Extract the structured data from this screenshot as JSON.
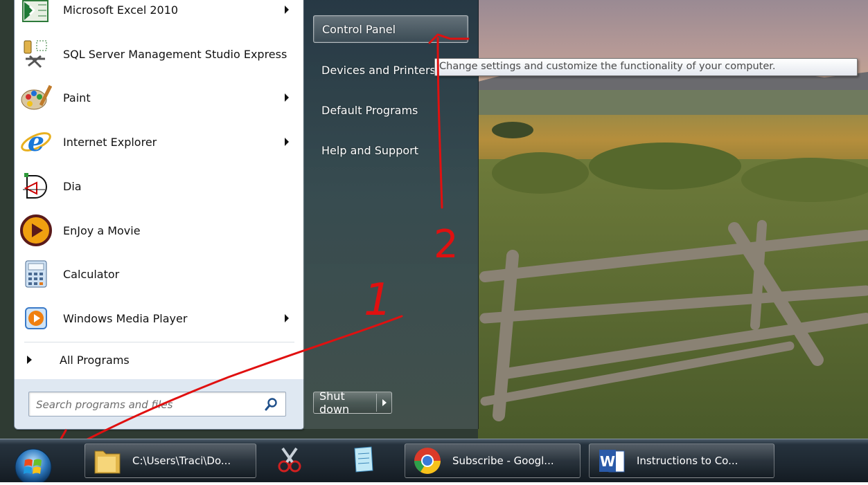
{
  "start_menu": {
    "programs": [
      {
        "label": "Microsoft Excel 2010",
        "icon": "excel-icon",
        "has_submenu": true
      },
      {
        "label": "SQL Server Management Studio Express",
        "icon": "sql-server-icon",
        "has_submenu": false
      },
      {
        "label": "Paint",
        "icon": "paint-icon",
        "has_submenu": true
      },
      {
        "label": "Internet Explorer",
        "icon": "internet-explorer-icon",
        "has_submenu": true
      },
      {
        "label": "Dia",
        "icon": "dia-icon",
        "has_submenu": false
      },
      {
        "label": "EnJoy a Movie",
        "icon": "movie-icon",
        "has_submenu": false
      },
      {
        "label": "Calculator",
        "icon": "calculator-icon",
        "has_submenu": false
      },
      {
        "label": "Windows Media Player",
        "icon": "media-player-icon",
        "has_submenu": true
      }
    ],
    "all_programs_label": "All Programs",
    "search": {
      "placeholder": "Search programs and files",
      "value": ""
    },
    "right_links": [
      {
        "label": "Control Panel",
        "highlighted": true
      },
      {
        "label": "Devices and Printers",
        "highlighted": false
      },
      {
        "label": "Default Programs",
        "highlighted": false
      },
      {
        "label": "Help and Support",
        "highlighted": false
      }
    ],
    "shutdown_label": "Shut down"
  },
  "tooltip": {
    "text": "Change settings and customize the functionality of your computer."
  },
  "annotations": {
    "step1_label": "1",
    "step2_label": "2",
    "color": "#e01010"
  },
  "taskbar": {
    "tasks": [
      {
        "label": "C:\\Users\\Traci\\Do...",
        "icon": "folder-icon"
      },
      {
        "label": "Subscribe - Googl...",
        "icon": "chrome-icon"
      },
      {
        "label": "Instructions to Co...",
        "icon": "word-icon"
      }
    ],
    "pinned": [
      {
        "icon": "snipping-tool-icon"
      },
      {
        "icon": "notepad-icon"
      }
    ]
  },
  "colors": {
    "taskbar": "#1d2730",
    "start_menu_right": "#263846",
    "tooltip_border": "#767676"
  }
}
